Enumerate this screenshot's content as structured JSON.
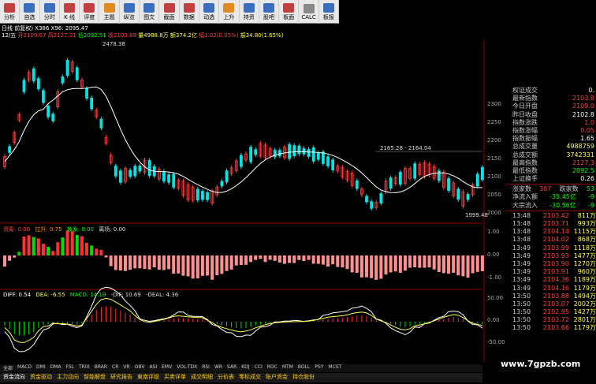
{
  "toolbar": [
    {
      "label": "分析",
      "color": "#c04040"
    },
    {
      "label": "自选",
      "color": "#3a6fc0"
    },
    {
      "label": "分时",
      "color": "#3a6fc0"
    },
    {
      "label": "K 线",
      "color": "#c04040"
    },
    {
      "label": "评度",
      "color": "#c04040"
    },
    {
      "label": "主题",
      "color": "#e08a20"
    },
    {
      "label": "纵览",
      "color": "#3a6fc0"
    },
    {
      "label": "图文",
      "color": "#3a6fc0"
    },
    {
      "label": "截面",
      "color": "#c04040"
    },
    {
      "label": "数据",
      "color": "#c04040"
    },
    {
      "label": "动选",
      "color": "#3a6fc0"
    },
    {
      "label": "上升",
      "color": "#e08a20"
    },
    {
      "label": "持资",
      "color": "#3a6fc0"
    },
    {
      "label": "股吧",
      "color": "#3a6fc0"
    },
    {
      "label": "板面",
      "color": "#c04040"
    },
    {
      "label": "CALC",
      "color": "#888888"
    },
    {
      "label": "板报",
      "color": "#3a6fc0"
    }
  ],
  "info": {
    "line1": "日线 前复权) X386 X96: 2095.47",
    "line2": "12/五 开2109.07 高2127.31 低2092.51 收2103.89 量4988.8万 额374.2亿 幅1.02(0.05%) 振34.80(1.65%)"
  },
  "chart_data": {
    "type": "candlestick",
    "annotations": {
      "high": "2478.38",
      "mid": "2165.28 - 2164.04",
      "low": "1999.48"
    },
    "yticks": [
      "2300",
      "2250",
      "2200",
      "2150",
      "2100",
      "2050",
      "2000"
    ],
    "mid_yticks": [
      "1.00",
      "0.00",
      "-1.00"
    ],
    "low_yticks": [
      "50.00",
      "0.00",
      "-50.00"
    ],
    "mid_label": {
      "a": "资筹: 0.00",
      "b": "拉升: 0.75",
      "c": "拨发: 0.00",
      "d": "离场: 0.00"
    },
    "low_label": {
      "a": "DIFF: 0.54",
      "b": "DEA: -6.55",
      "c": "MACD: 14.19",
      "d": "-DIF: 10.69",
      "e": "-DEAL: 4.36"
    }
  },
  "panel": {
    "title": "权证成交",
    "title_val": "0.",
    "rows": [
      {
        "label": "最新指数",
        "value": "2103.8",
        "color": "#ff4040"
      },
      {
        "label": "今日开盘",
        "value": "2109.0",
        "color": "#ff4040"
      },
      {
        "label": "昨日收盘",
        "value": "2102.8",
        "color": "#ffffff"
      },
      {
        "label": "指数涨跌",
        "value": "1.0",
        "color": "#ff4040"
      },
      {
        "label": "指数涨幅",
        "value": "0.05",
        "color": "#ff4040"
      },
      {
        "label": "指数振幅",
        "value": "1.65",
        "color": "#ffffff"
      },
      {
        "label": "总成交量",
        "value": "4988759",
        "color": "#ffff44"
      },
      {
        "label": "总成交额",
        "value": "3742331",
        "color": "#ffff44"
      },
      {
        "label": "最高指数",
        "value": "2127.3",
        "color": "#ff4040"
      },
      {
        "label": "最低指数",
        "value": "2092.5",
        "color": "#00ff00"
      },
      {
        "label": "上证换手",
        "value": "0.26",
        "color": "#ffffff"
      }
    ],
    "breadth": {
      "up_label": "涨家数",
      "up": "387",
      "down_label": "跌家数",
      "down": "53"
    },
    "flow": [
      {
        "label": "净流入额",
        "value": "-35.45亿",
        "extra": "-9"
      },
      {
        "label": "大宗流入",
        "value": "-30.56亿",
        "extra": "-9"
      }
    ],
    "ticks": [
      {
        "t": "13:48",
        "p": "2103.42",
        "v": "811万"
      },
      {
        "t": "13:48",
        "p": "2103.71",
        "v": "993万"
      },
      {
        "t": "13:48",
        "p": "2104.14",
        "v": "1115万"
      },
      {
        "t": "13:48",
        "p": "2104.02",
        "v": "868万"
      },
      {
        "t": "13:49",
        "p": "2103.99",
        "v": "1118万"
      },
      {
        "t": "13:49",
        "p": "2103.93",
        "v": "1477万"
      },
      {
        "t": "13:49",
        "p": "2103.90",
        "v": "1270万"
      },
      {
        "t": "13:49",
        "p": "2103.91",
        "v": "960万"
      },
      {
        "t": "13:49",
        "p": "2104.36",
        "v": "1189万"
      },
      {
        "t": "13:49",
        "p": "2104.16",
        "v": "1179万"
      },
      {
        "t": "13:50",
        "p": "2103.88",
        "v": "1494万"
      },
      {
        "t": "13:50",
        "p": "2103.07",
        "v": "2002万"
      },
      {
        "t": "13:50",
        "p": "2102.95",
        "v": "1427万"
      },
      {
        "t": "13:50",
        "p": "2103.72",
        "v": "2801万"
      },
      {
        "t": "13:50",
        "p": "2103.66",
        "v": "1179万"
      }
    ]
  },
  "indicators": [
    "全部",
    "MACD",
    "DMI",
    "DMA",
    "FSL",
    "TRIX",
    "BRAR",
    "CR",
    "VR",
    "OBV",
    "ASI",
    "EMV",
    "VOL-TDX",
    "RSI",
    "WR",
    "SAR",
    "KDJ",
    "CCI",
    "ROC",
    "MTM",
    "BOLL",
    "PSY",
    "MCST"
  ],
  "tabs": [
    "资金流向",
    "资金驱动",
    "主力动向",
    "智能解盘",
    "研究报告",
    "東南评级",
    "买卖详单",
    "成交明细",
    "分价表",
    "零标成交",
    "账户资金",
    "持仓股份"
  ],
  "watermark": "www.7gpzb.com"
}
